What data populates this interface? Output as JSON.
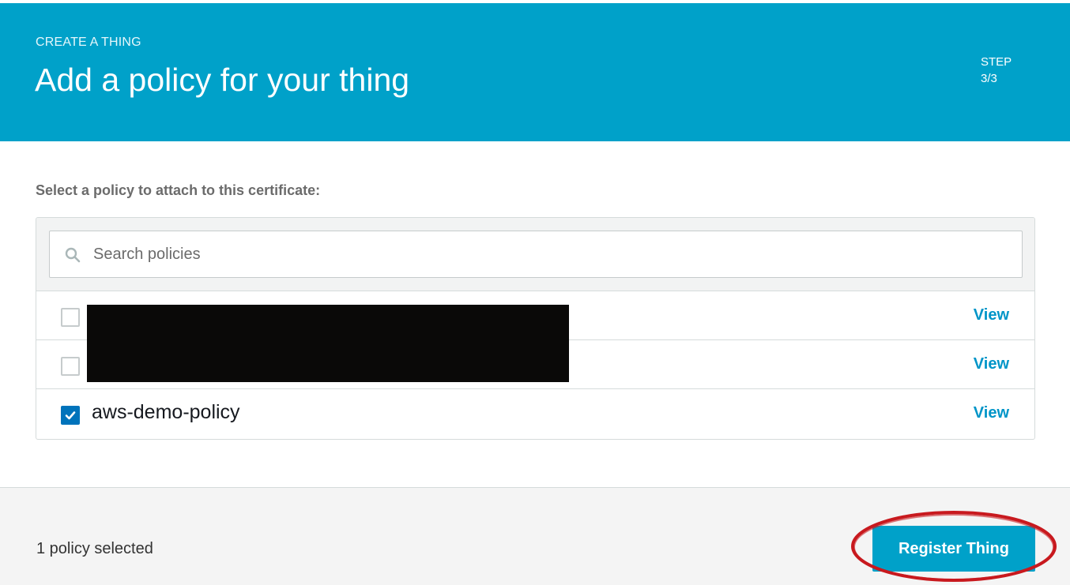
{
  "header": {
    "eyebrow": "CREATE A THING",
    "title": "Add a policy for your thing",
    "step_label": "STEP",
    "step_value": "3/3"
  },
  "section": {
    "label": "Select a policy to attach to this certificate:"
  },
  "search": {
    "placeholder": "Search policies",
    "value": "",
    "icon": "search-icon"
  },
  "policies": [
    {
      "name": "",
      "checked": false,
      "view_label": "View"
    },
    {
      "name": "",
      "checked": false,
      "view_label": "View"
    },
    {
      "name": "aws-demo-policy",
      "checked": true,
      "view_label": "View"
    }
  ],
  "footer": {
    "selected_text": "1 policy selected",
    "register_label": "Register Thing"
  },
  "colors": {
    "header_bg": "#00a1c9",
    "link": "#0095c8",
    "checkbox_checked": "#0073bb",
    "annotation": "#c8191e"
  }
}
